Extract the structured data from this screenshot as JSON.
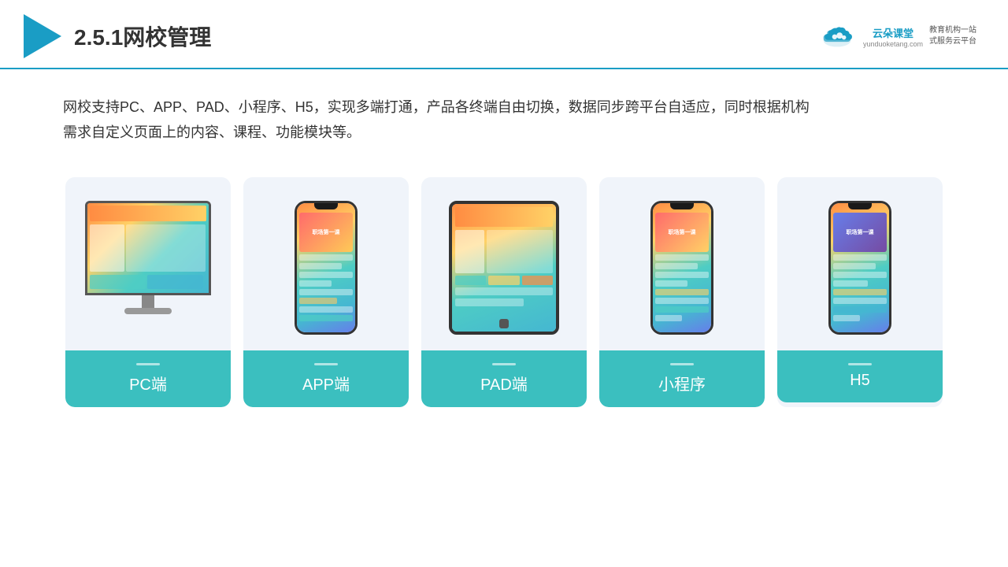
{
  "header": {
    "title": "2.5.1网校管理",
    "brand": {
      "name": "云朵课堂",
      "url": "yunduoketang.com",
      "tagline": "教育机构一站\n式服务云平台"
    }
  },
  "description": "网校支持PC、APP、PAD、小程序、H5，实现多端打通，产品各终端自由切换，数据同步跨平台自适应，同时根据机构\n需求自定义页面上的内容、课程、功能模块等。",
  "cards": [
    {
      "id": "pc",
      "label": "PC端"
    },
    {
      "id": "app",
      "label": "APP端"
    },
    {
      "id": "pad",
      "label": "PAD端"
    },
    {
      "id": "miniprogram",
      "label": "小程序"
    },
    {
      "id": "h5",
      "label": "H5"
    }
  ],
  "accent_color": "#3bbfbf",
  "header_line_color": "#1a9dc5"
}
